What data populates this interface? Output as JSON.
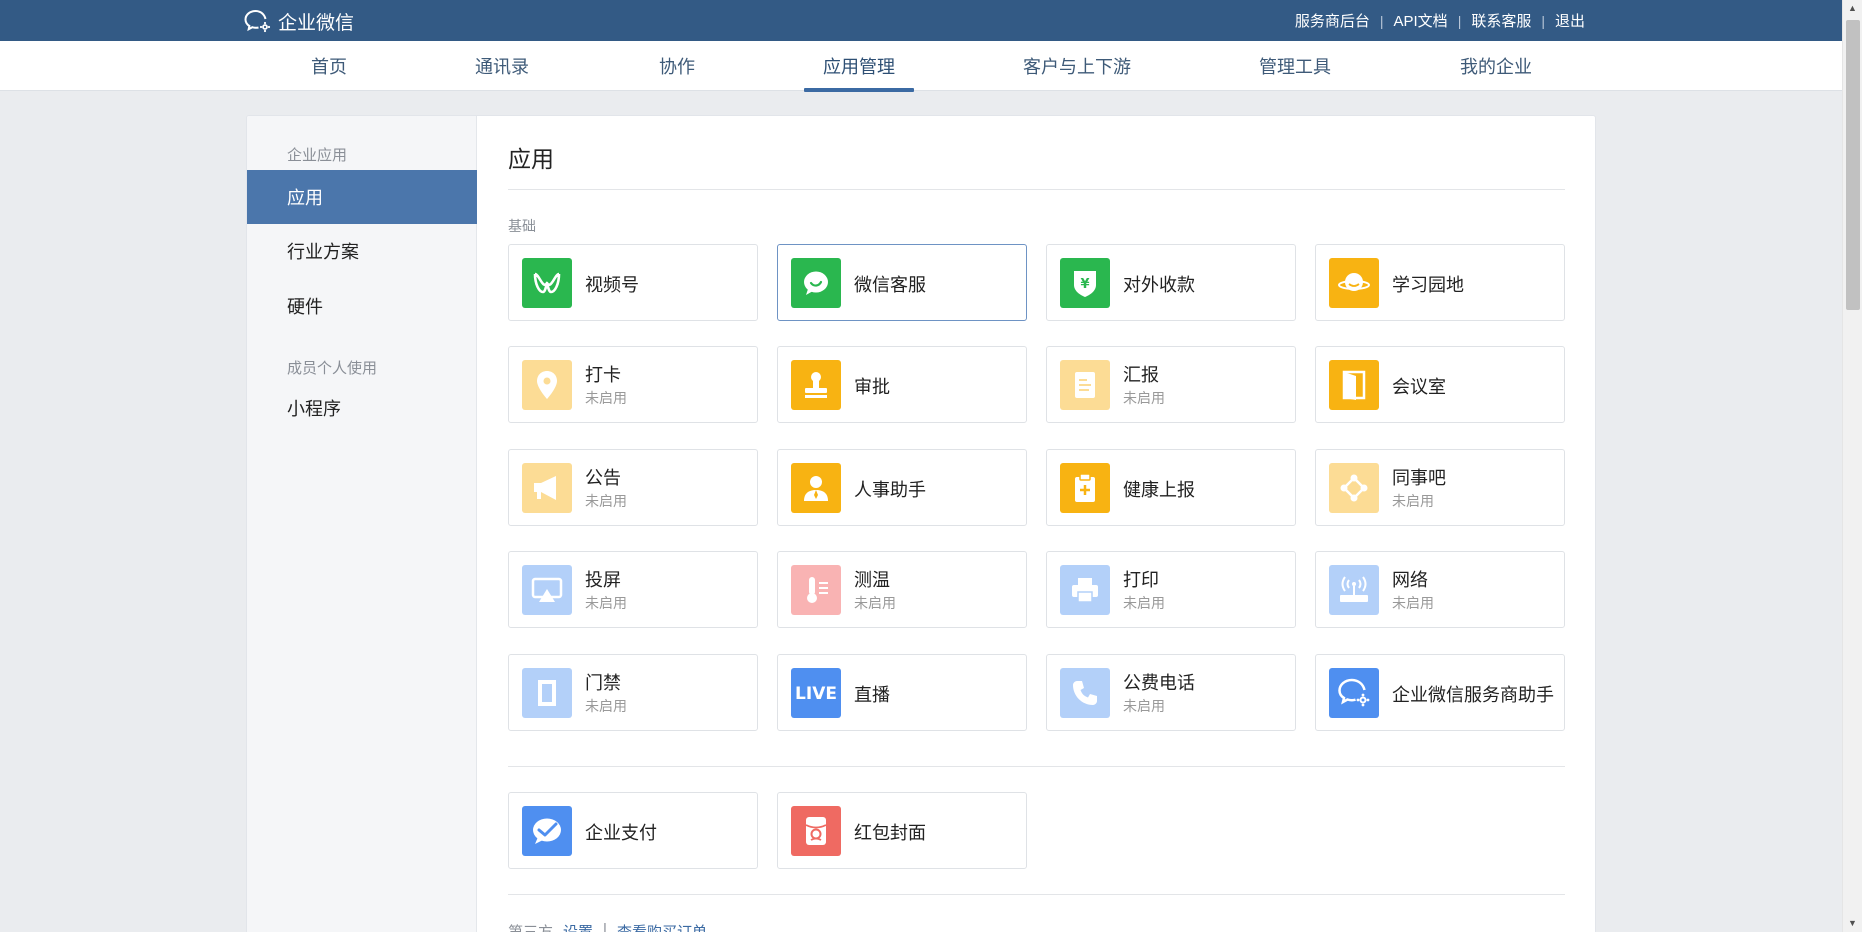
{
  "header": {
    "brand": "企业微信",
    "links": [
      "服务商后台",
      "API文档",
      "联系客服",
      "退出"
    ]
  },
  "nav": {
    "tabs": [
      {
        "label": "首页"
      },
      {
        "label": "通讯录"
      },
      {
        "label": "协作"
      },
      {
        "label": "应用管理"
      },
      {
        "label": "客户与上下游"
      },
      {
        "label": "管理工具"
      },
      {
        "label": "我的企业"
      }
    ],
    "active": "应用管理"
  },
  "sidebar": {
    "section1": "企业应用",
    "items1": [
      "应用",
      "行业方案",
      "硬件"
    ],
    "section2": "成员个人使用",
    "items2": [
      "小程序"
    ]
  },
  "main": {
    "title": "应用",
    "group_label": "基础",
    "apps": [
      {
        "name": "视频号",
        "status": "",
        "icon": "channels-icon",
        "color": "#2ab74f"
      },
      {
        "name": "微信客服",
        "status": "",
        "icon": "wechat-service-icon",
        "color": "#2ab74f"
      },
      {
        "name": "对外收款",
        "status": "",
        "icon": "payment-shield-icon",
        "color": "#2ab74f"
      },
      {
        "name": "学习园地",
        "status": "",
        "icon": "planet-icon",
        "color": "#f8b312"
      },
      {
        "name": "打卡",
        "status": "未启用",
        "icon": "location-pin-icon",
        "color": "#fcdc95"
      },
      {
        "name": "审批",
        "status": "",
        "icon": "stamp-icon",
        "color": "#f8b312"
      },
      {
        "name": "汇报",
        "status": "未启用",
        "icon": "report-document-icon",
        "color": "#fcdc95"
      },
      {
        "name": "会议室",
        "status": "",
        "icon": "door-icon",
        "color": "#f8b312"
      },
      {
        "name": "公告",
        "status": "未启用",
        "icon": "megaphone-icon",
        "color": "#fcdc95"
      },
      {
        "name": "人事助手",
        "status": "",
        "icon": "person-icon",
        "color": "#f8b312"
      },
      {
        "name": "健康上报",
        "status": "",
        "icon": "health-clipboard-icon",
        "color": "#f8b312"
      },
      {
        "name": "同事吧",
        "status": "未启用",
        "icon": "network-nodes-icon",
        "color": "#fcdc95"
      },
      {
        "name": "投屏",
        "status": "未启用",
        "icon": "screencast-icon",
        "color": "#b3d0f9"
      },
      {
        "name": "测温",
        "status": "未启用",
        "icon": "thermometer-icon",
        "color": "#f9b3b3"
      },
      {
        "name": "打印",
        "status": "未启用",
        "icon": "printer-icon",
        "color": "#b3d0f9"
      },
      {
        "name": "网络",
        "status": "未启用",
        "icon": "router-icon",
        "color": "#b3d0f9"
      },
      {
        "name": "门禁",
        "status": "未启用",
        "icon": "access-door-icon",
        "color": "#b3d0f9"
      },
      {
        "name": "直播",
        "status": "",
        "icon": "live-icon",
        "color": "#4f8ff0"
      },
      {
        "name": "公费电话",
        "status": "未启用",
        "icon": "phone-icon",
        "color": "#b3d0f9"
      },
      {
        "name": "企业微信服务商助手",
        "status": "",
        "icon": "wecom-assistant-icon",
        "color": "#4f8ff0"
      }
    ],
    "apps2": [
      {
        "name": "企业支付",
        "status": "",
        "icon": "enterprise-pay-icon",
        "color": "#4f8ff0"
      },
      {
        "name": "红包封面",
        "status": "",
        "icon": "red-envelope-icon",
        "color": "#ef6a62"
      }
    ],
    "footer": {
      "label": "第三方",
      "link1": "设置",
      "sep": "|",
      "link2": "查看购买订单"
    }
  }
}
